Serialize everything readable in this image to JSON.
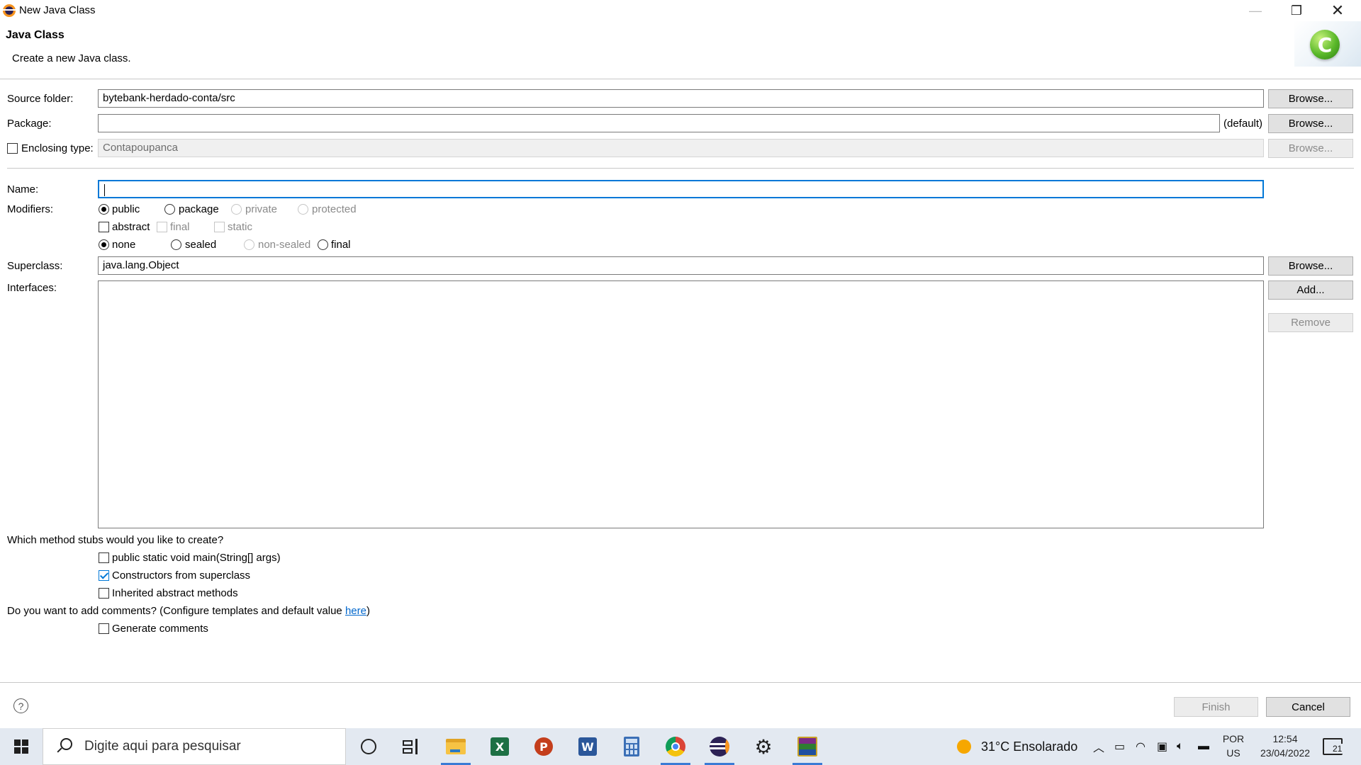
{
  "window": {
    "title": "New Java Class",
    "controls": {
      "minimize": "—",
      "maximize": "❐",
      "close": "✕"
    }
  },
  "banner": {
    "heading": "Java Class",
    "description": "Create a new Java class.",
    "icon_letter": "C"
  },
  "form": {
    "source_folder": {
      "label": "Source folder:",
      "value": "bytebank-herdado-conta/src",
      "browse": "Browse..."
    },
    "package": {
      "label": "Package:",
      "value": "",
      "hint": "(default)",
      "browse": "Browse..."
    },
    "enclosing_type": {
      "label": "Enclosing type:",
      "value": "Contapoupanca",
      "browse": "Browse...",
      "checked": false
    },
    "name": {
      "label": "Name:",
      "value": ""
    },
    "modifiers": {
      "label": "Modifiers:",
      "access": [
        "public",
        "package",
        "private",
        "protected"
      ],
      "access_selected": "public",
      "flags": [
        "abstract",
        "final",
        "static"
      ],
      "inheritance": [
        "none",
        "sealed",
        "non-sealed",
        "final"
      ],
      "inheritance_selected": "none"
    },
    "superclass": {
      "label": "Superclass:",
      "value": "java.lang.Object",
      "browse": "Browse..."
    },
    "interfaces": {
      "label": "Interfaces:",
      "add": "Add...",
      "remove": "Remove"
    },
    "stubs": {
      "question": "Which method stubs would you like to create?",
      "main": "public static void main(String[] args)",
      "constructors": "Constructors from superclass",
      "inherited": "Inherited abstract methods",
      "constructors_checked": true
    },
    "comments": {
      "question": "Do you want to add comments? (Configure templates and default value ",
      "link": "here",
      "close_paren": ")",
      "generate": "Generate comments"
    }
  },
  "footer": {
    "help": "?",
    "finish": "Finish",
    "cancel": "Cancel"
  },
  "taskbar": {
    "search_placeholder": "Digite aqui para pesquisar",
    "apps": [
      "cortana-icon",
      "task-view-icon",
      "file-explorer-icon",
      "excel-icon",
      "powerpoint-icon",
      "word-icon",
      "calculator-icon",
      "chrome-icon",
      "eclipse-icon",
      "settings-icon",
      "winrar-icon"
    ],
    "weather": "31°C  Ensolarado",
    "language": "POR",
    "layout": "US",
    "time": "12:54",
    "date": "23/04/2022",
    "notifications": "21"
  }
}
